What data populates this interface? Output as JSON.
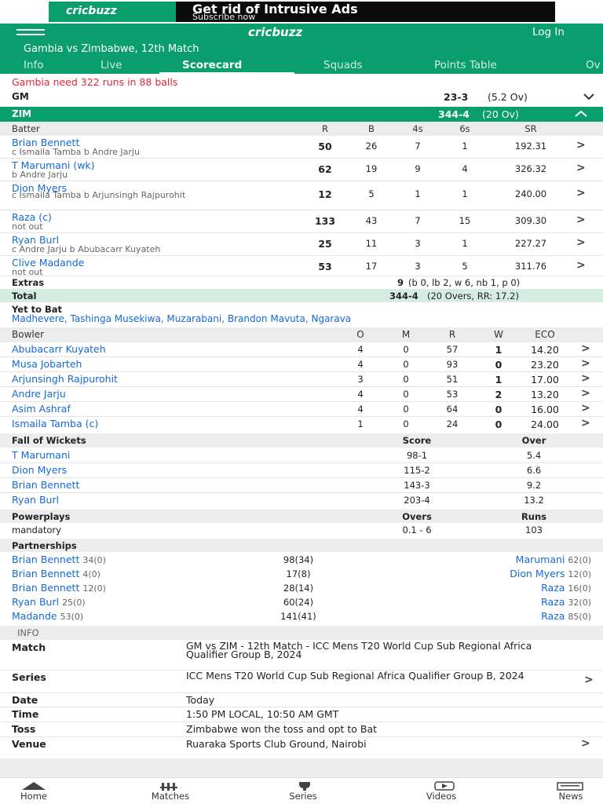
{
  "ad": {
    "logo": "cricbuzz",
    "title": "Get rid of Intrusive Ads",
    "subtitle": "Subscribe now"
  },
  "header": {
    "logo": "cricbuzz",
    "login": "Log In",
    "match_title": "Gambia vs Zimbabwe, 12th Match"
  },
  "tabs": [
    "Info",
    "Live",
    "Scorecard",
    "Squads",
    "Points Table",
    "Ov"
  ],
  "status": "Gambia need 322 runs in 88 balls",
  "innings_gm": {
    "team": "GM",
    "score": "23-3",
    "overs": "(5.2 Ov)"
  },
  "innings_zim": {
    "team": "ZIM",
    "score": "344-4",
    "overs": "(20 Ov)"
  },
  "batting_headers": [
    "Batter",
    "R",
    "B",
    "4s",
    "6s",
    "SR"
  ],
  "batters": [
    {
      "name": "Brian Bennett",
      "dismissal": "c Ismaila Tamba b Andre Jarju",
      "r": "50",
      "b": "26",
      "fours": "7",
      "sixes": "1",
      "sr": "192.31"
    },
    {
      "name": "T Marumani (wk)",
      "dismissal": "b Andre Jarju",
      "r": "62",
      "b": "19",
      "fours": "9",
      "sixes": "4",
      "sr": "326.32"
    },
    {
      "name": "Dion Myers",
      "dismissal": "c Ismaila Tamba b Arjunsingh Rajpurohit",
      "r": "12",
      "b": "5",
      "fours": "1",
      "sixes": "1",
      "sr": "240.00"
    },
    {
      "name": "Raza (c)",
      "dismissal": "not out",
      "r": "133",
      "b": "43",
      "fours": "7",
      "sixes": "15",
      "sr": "309.30"
    },
    {
      "name": "Ryan Burl",
      "dismissal": "c Andre Jarju b Abubacarr Kuyateh",
      "r": "25",
      "b": "11",
      "fours": "3",
      "sixes": "1",
      "sr": "227.27"
    },
    {
      "name": "Clive Madande",
      "dismissal": "not out",
      "r": "53",
      "b": "17",
      "fours": "3",
      "sixes": "5",
      "sr": "311.76"
    }
  ],
  "extras": {
    "label": "Extras",
    "value": "9",
    "detail": "(b 0, lb 2, w 6, nb 1, p 0)"
  },
  "total": {
    "label": "Total",
    "value": "344-4",
    "detail": "(20 Overs, RR: 17.2)"
  },
  "yet_to_bat": {
    "label": "Yet to Bat",
    "players": "Madhevere, Tashinga Musekiwa, Muzarabani, Brandon Mavuta, Ngarava"
  },
  "bowling_headers": [
    "Bowler",
    "O",
    "M",
    "R",
    "W",
    "ECO"
  ],
  "bowlers": [
    {
      "name": "Abubacarr Kuyateh",
      "o": "4",
      "m": "0",
      "r": "57",
      "w": "1",
      "eco": "14.20"
    },
    {
      "name": "Musa Jobarteh",
      "o": "4",
      "m": "0",
      "r": "93",
      "w": "0",
      "eco": "23.20"
    },
    {
      "name": "Arjunsingh Rajpurohit",
      "o": "3",
      "m": "0",
      "r": "51",
      "w": "1",
      "eco": "17.00"
    },
    {
      "name": "Andre Jarju",
      "o": "4",
      "m": "0",
      "r": "53",
      "w": "2",
      "eco": "13.20"
    },
    {
      "name": "Asim Ashraf",
      "o": "4",
      "m": "0",
      "r": "64",
      "w": "0",
      "eco": "16.00"
    },
    {
      "name": "Ismaila Tamba (c)",
      "o": "1",
      "m": "0",
      "r": "24",
      "w": "0",
      "eco": "24.00"
    }
  ],
  "fow_headers": [
    "Fall of Wickets",
    "Score",
    "Over"
  ],
  "fow": [
    {
      "name": "T Marumani",
      "score": "98-1",
      "over": "5.4"
    },
    {
      "name": "Dion Myers",
      "score": "115-2",
      "over": "6.6"
    },
    {
      "name": "Brian Bennett",
      "score": "143-3",
      "over": "9.2"
    },
    {
      "name": "Ryan Burl",
      "score": "203-4",
      "over": "13.2"
    }
  ],
  "powerplay_headers": [
    "Powerplays",
    "Overs",
    "Runs"
  ],
  "powerplay": {
    "name": "mandatory",
    "overs": "0.1 - 6",
    "runs": "103"
  },
  "partnerships_label": "Partnerships",
  "partnerships": [
    {
      "p1": "Brian Bennett",
      "p1s": "34(0)",
      "total": "98(34)",
      "p2": "Marumani",
      "p2s": "62(0)"
    },
    {
      "p1": "Brian Bennett",
      "p1s": "4(0)",
      "total": "17(8)",
      "p2": "Dion Myers",
      "p2s": "12(0)"
    },
    {
      "p1": "Brian Bennett",
      "p1s": "12(0)",
      "total": "28(14)",
      "p2": "Raza",
      "p2s": "16(0)"
    },
    {
      "p1": "Ryan Burl",
      "p1s": "25(0)",
      "total": "60(24)",
      "p2": "Raza",
      "p2s": "32(0)"
    },
    {
      "p1": "Madande",
      "p1s": "53(0)",
      "total": "141(41)",
      "p2": "Raza",
      "p2s": "85(0)"
    }
  ],
  "info": {
    "header": "INFO",
    "match_label": "Match",
    "match": "GM vs ZIM - 12th Match - ICC Mens T20 World Cup Sub Regional Africa Qualifier Group B, 2024",
    "series_label": "Series",
    "series": "ICC Mens T20 World Cup Sub Regional Africa Qualifier Group B, 2024",
    "date_label": "Date",
    "date": "Today",
    "time_label": "Time",
    "time": "1:50 PM LOCAL, 10:50 AM GMT",
    "toss_label": "Toss",
    "toss": "Zimbabwe won the toss and opt to Bat",
    "venue_label": "Venue",
    "venue": "Ruaraka Sports Club Ground, Nairobi"
  },
  "bottom_nav": [
    "Home",
    "Matches",
    "Series",
    "Videos",
    "News"
  ],
  "colors": {
    "brand": "#0a9e6e",
    "link": "#1569d6",
    "alert": "#e0263a",
    "total_bg": "#d5ece3"
  },
  "icons": [
    "hamburger-icon",
    "chevron-down-icon",
    "chevron-up-icon",
    "chevron-right-icon",
    "home-icon",
    "matches-icon",
    "trophy-icon",
    "play-icon",
    "news-icon"
  ]
}
